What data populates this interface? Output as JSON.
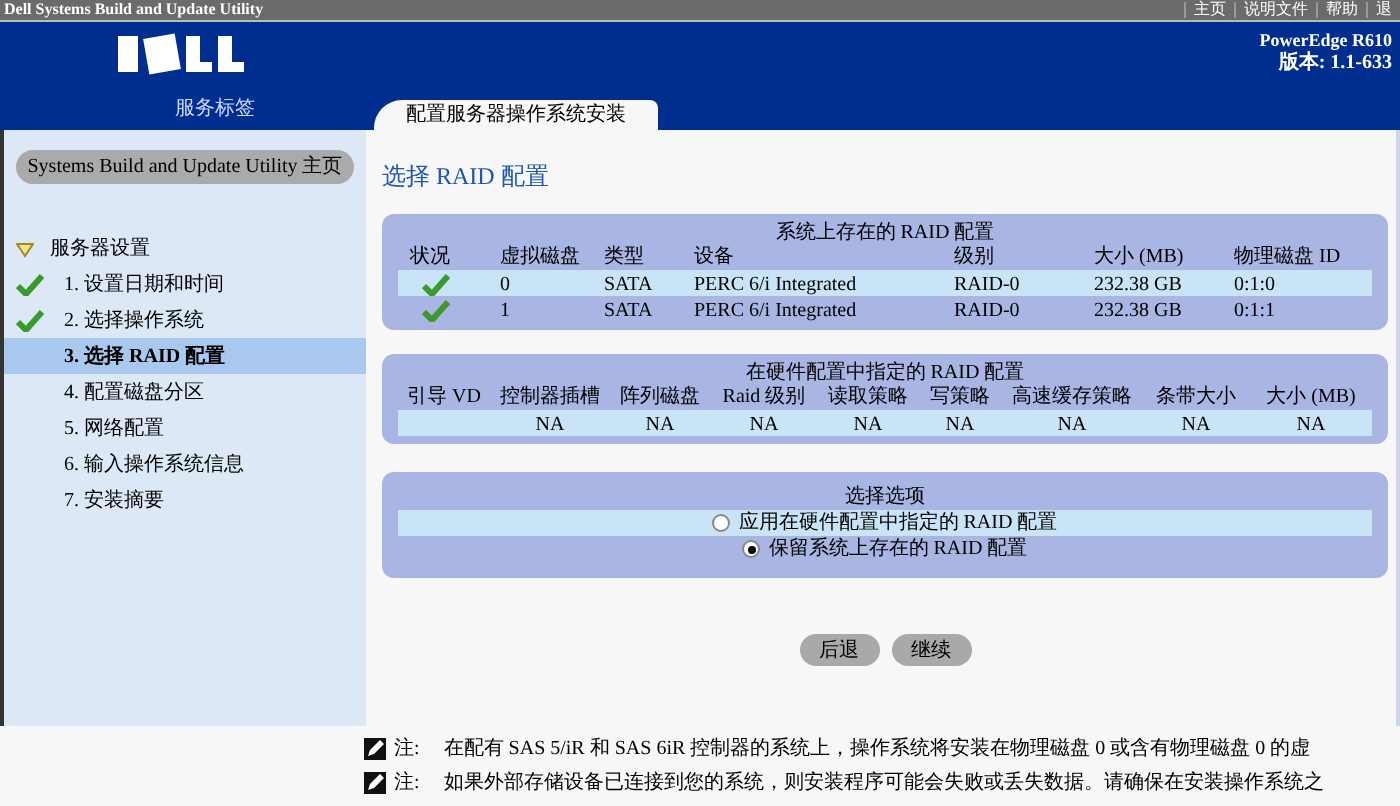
{
  "window": {
    "title": "Dell Systems Build and Update Utility"
  },
  "top_links": [
    "主页",
    "说明文件",
    "帮助",
    "退"
  ],
  "header": {
    "service_tag_label": "服务标签",
    "model": "PowerEdge R610",
    "version": "版本: 1.1-633"
  },
  "tabs": [
    {
      "label": "配置服务器操作系统安装",
      "selected": true
    }
  ],
  "sidebar": {
    "home_button": "Systems Build and Update Utility 主页",
    "items": [
      {
        "label": "服务器设置",
        "expanded": true,
        "children": [
          {
            "label": "1. 设置日期和时间",
            "done": true,
            "selected": false
          },
          {
            "label": "2. 选择操作系统",
            "done": true,
            "selected": false
          },
          {
            "label": "3. 选择 RAID 配置",
            "done": false,
            "selected": true
          },
          {
            "label": "4. 配置磁盘分区",
            "done": false,
            "selected": false
          },
          {
            "label": "5. 网络配置",
            "done": false,
            "selected": false
          },
          {
            "label": "6. 输入操作系统信息",
            "done": false,
            "selected": false
          },
          {
            "label": "7. 安装摘要",
            "done": false,
            "selected": false
          }
        ]
      }
    ]
  },
  "page_title": "选择 RAID 配置",
  "existing_raid": {
    "title": "系统上存在的 RAID 配置",
    "columns": [
      "状况",
      "虚拟磁盘",
      "类型",
      "设备",
      "级别",
      "大小 (MB)",
      "物理磁盘 ID"
    ],
    "rows": [
      {
        "status_ok": true,
        "selected": true,
        "cells": [
          "",
          "0",
          "SATA",
          "PERC 6/i Integrated",
          "RAID-0",
          "232.38 GB",
          "0:1:0"
        ]
      },
      {
        "status_ok": true,
        "selected": false,
        "cells": [
          "",
          "1",
          "SATA",
          "PERC 6/i Integrated",
          "RAID-0",
          "232.38 GB",
          "0:1:1"
        ]
      }
    ]
  },
  "hardware_raid": {
    "title": "在硬件配置中指定的 RAID 配置",
    "columns": [
      "引导 VD",
      "控制器插槽",
      "阵列磁盘",
      "Raid 级别",
      "读取策略",
      "写策略",
      "高速缓存策略",
      "条带大小",
      "大小 (MB)"
    ],
    "rows": [
      {
        "cells": [
          "",
          "NA",
          "NA",
          "NA",
          "NA",
          "NA",
          "NA",
          "NA",
          "NA"
        ]
      }
    ]
  },
  "options": {
    "title": "选择选项",
    "items": [
      {
        "label": "应用在硬件配置中指定的 RAID 配置",
        "selected": false
      },
      {
        "label": "保留系统上存在的 RAID 配置",
        "selected": true
      }
    ]
  },
  "buttons": [
    "后退",
    "继续"
  ],
  "notes": [
    {
      "label": "注:",
      "text": "在配有 SAS 5/iR 和 SAS 6iR 控制器的系统上，操作系统将安装在物理磁盘 0 或含有物理磁盘 0 的虚"
    },
    {
      "label": "注:",
      "text": "如果外部存储设备已连接到您的系统，则安装程序可能会失败或丢失数据。请确保在安装操作系统之"
    }
  ]
}
